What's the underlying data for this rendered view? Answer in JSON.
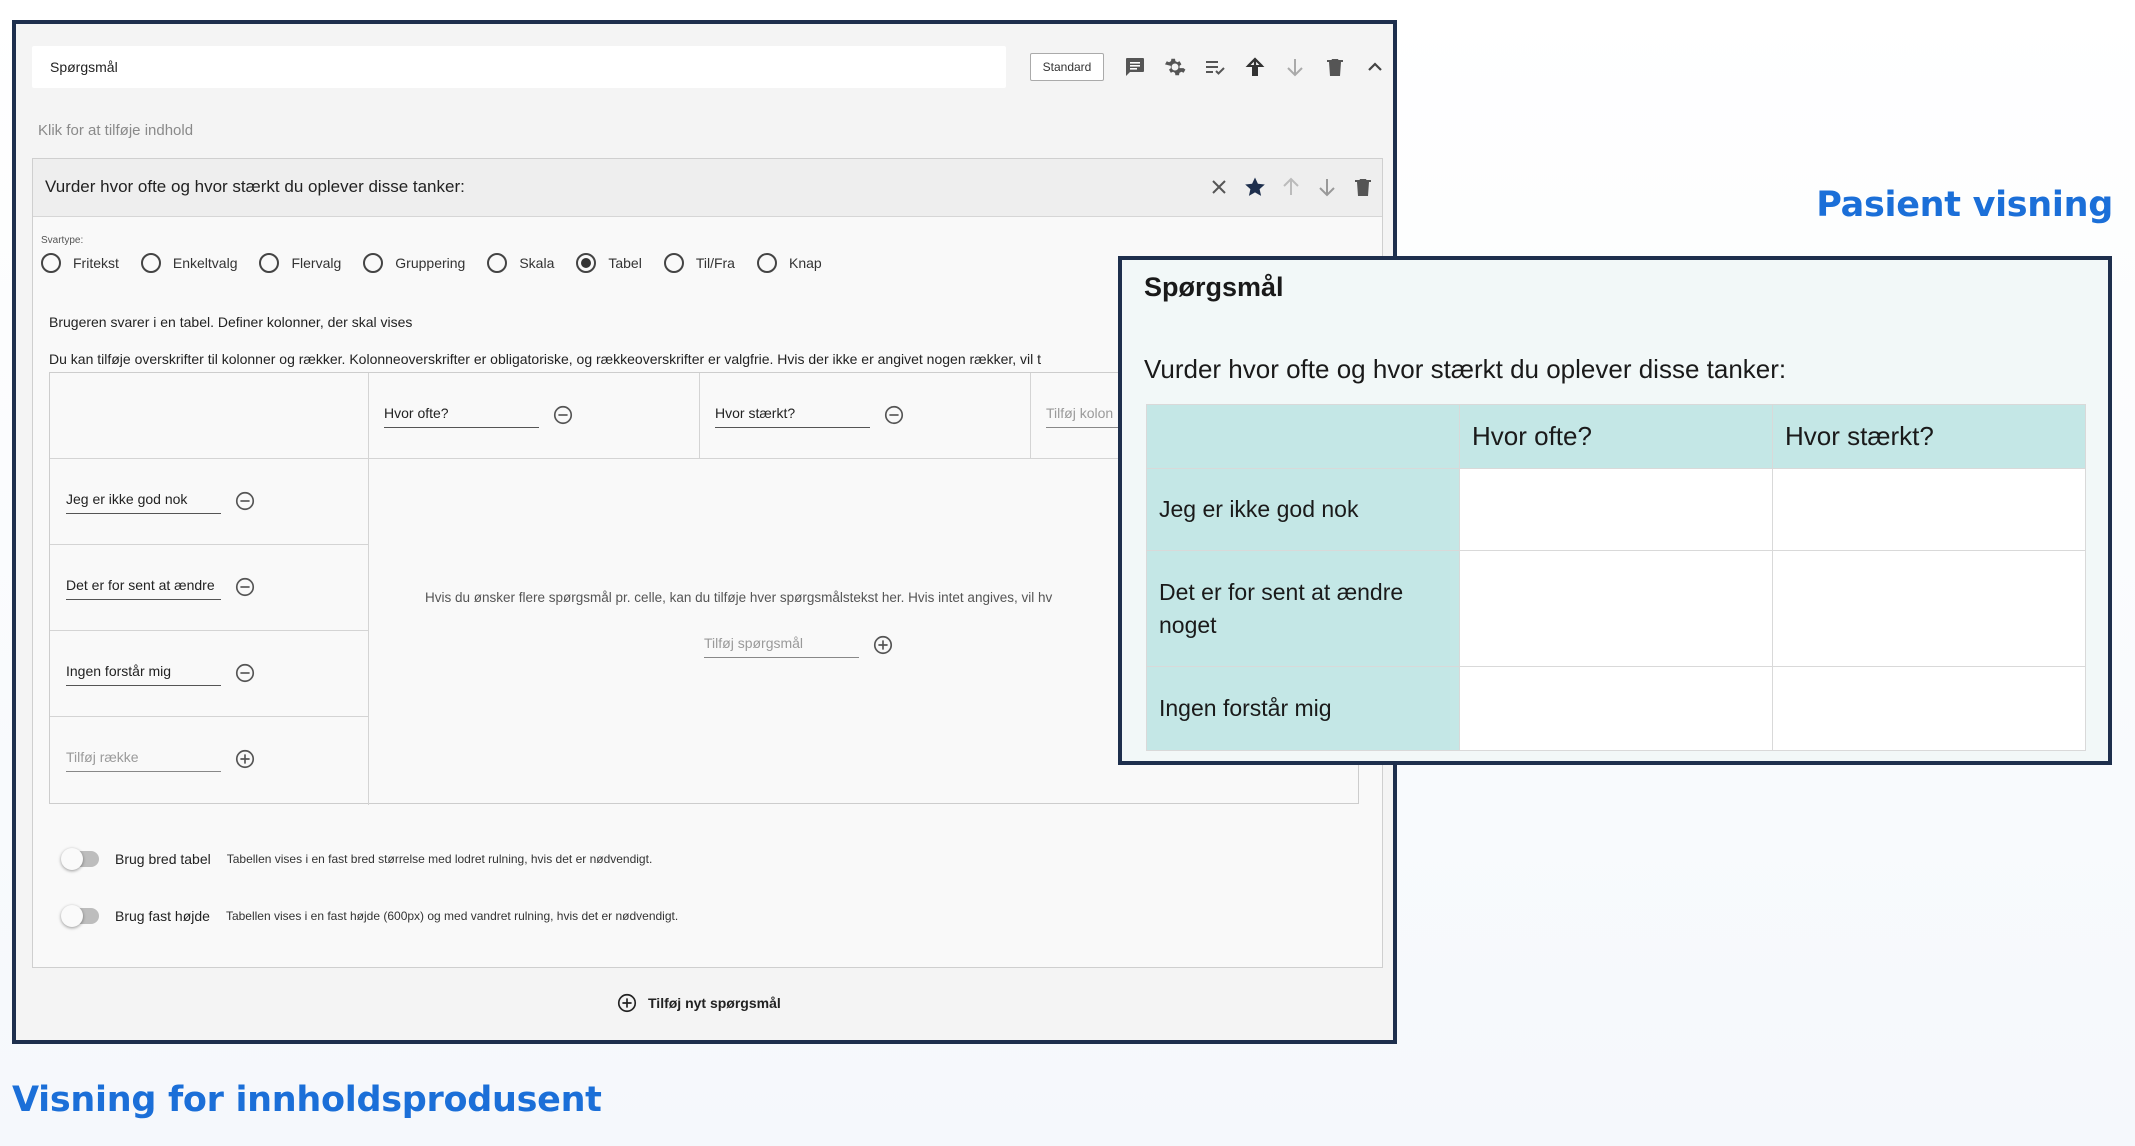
{
  "captions": {
    "editor": "Visning for innholdsprodusent",
    "patient": "Pasient visning"
  },
  "editor": {
    "title_value": "Spørgsmål",
    "standard_button": "Standard",
    "top_icons": [
      "comment-icon",
      "settings-icon",
      "checklist-icon",
      "arrow-up-icon",
      "arrow-down-icon",
      "delete-icon",
      "collapse-icon"
    ],
    "click_hint": "Klik for at tilføje indhold",
    "question": {
      "title": "Vurder hvor ofte og hvor stærkt du oplever disse tanker:",
      "icons": [
        "close-icon",
        "star-icon",
        "arrow-up-icon",
        "arrow-down-icon",
        "delete-icon"
      ],
      "svartype_label": "Svartype:",
      "answer_types": [
        {
          "label": "Fritekst",
          "selected": false
        },
        {
          "label": "Enkeltvalg",
          "selected": false
        },
        {
          "label": "Flervalg",
          "selected": false
        },
        {
          "label": "Gruppering",
          "selected": false
        },
        {
          "label": "Skala",
          "selected": false
        },
        {
          "label": "Tabel",
          "selected": true
        },
        {
          "label": "Til/Fra",
          "selected": false
        },
        {
          "label": "Knap",
          "selected": false
        }
      ],
      "description_1": "Brugeren svarer i en tabel. Definer kolonner, der skal vises",
      "description_2": "Du kan tilføje overskrifter til kolonner og rækker. Kolonneoverskrifter er obligatoriske, og rækkeoverskrifter er valgfrie. Hvis der ikke er angivet nogen rækker, vil t",
      "columns": [
        "Hvor ofte?",
        "Hvor stærkt?"
      ],
      "add_column_placeholder": "Tilføj kolon",
      "rows": [
        "Jeg er ikke god nok",
        "Det er for sent at ændre",
        "Ingen forstår mig"
      ],
      "add_row_placeholder": "Tilføj række",
      "cell_hint": "Hvis du ønsker flere spørgsmål pr. celle, kan du tilføje hver spørgsmålstekst her. Hvis intet angives, vil hv",
      "add_cell_question_placeholder": "Tilføj spørgsmål"
    },
    "toggles": [
      {
        "label": "Brug bred tabel",
        "description": "Tabellen vises i en fast bred størrelse med lodret rulning, hvis det er nødvendigt.",
        "on": false
      },
      {
        "label": "Brug fast højde",
        "description": "Tabellen vises i en fast højde (600px) og med vandret rulning, hvis det er nødvendigt.",
        "on": false
      }
    ],
    "add_question_label": "Tilføj nyt spørgsmål"
  },
  "patient": {
    "title": "Spørgsmål",
    "question": "Vurder hvor ofte og hvor stærkt du oplever disse tanker:",
    "columns": [
      "Hvor ofte?",
      "Hvor stærkt?"
    ],
    "rows": [
      "Jeg er ikke god nok",
      "Det er for sent at ændre noget",
      "Ingen forstår mig"
    ]
  },
  "colors": {
    "caption_blue": "#1b6fd8",
    "frame_navy": "#1e2f4d",
    "patient_header_teal": "#c4e7e6"
  }
}
